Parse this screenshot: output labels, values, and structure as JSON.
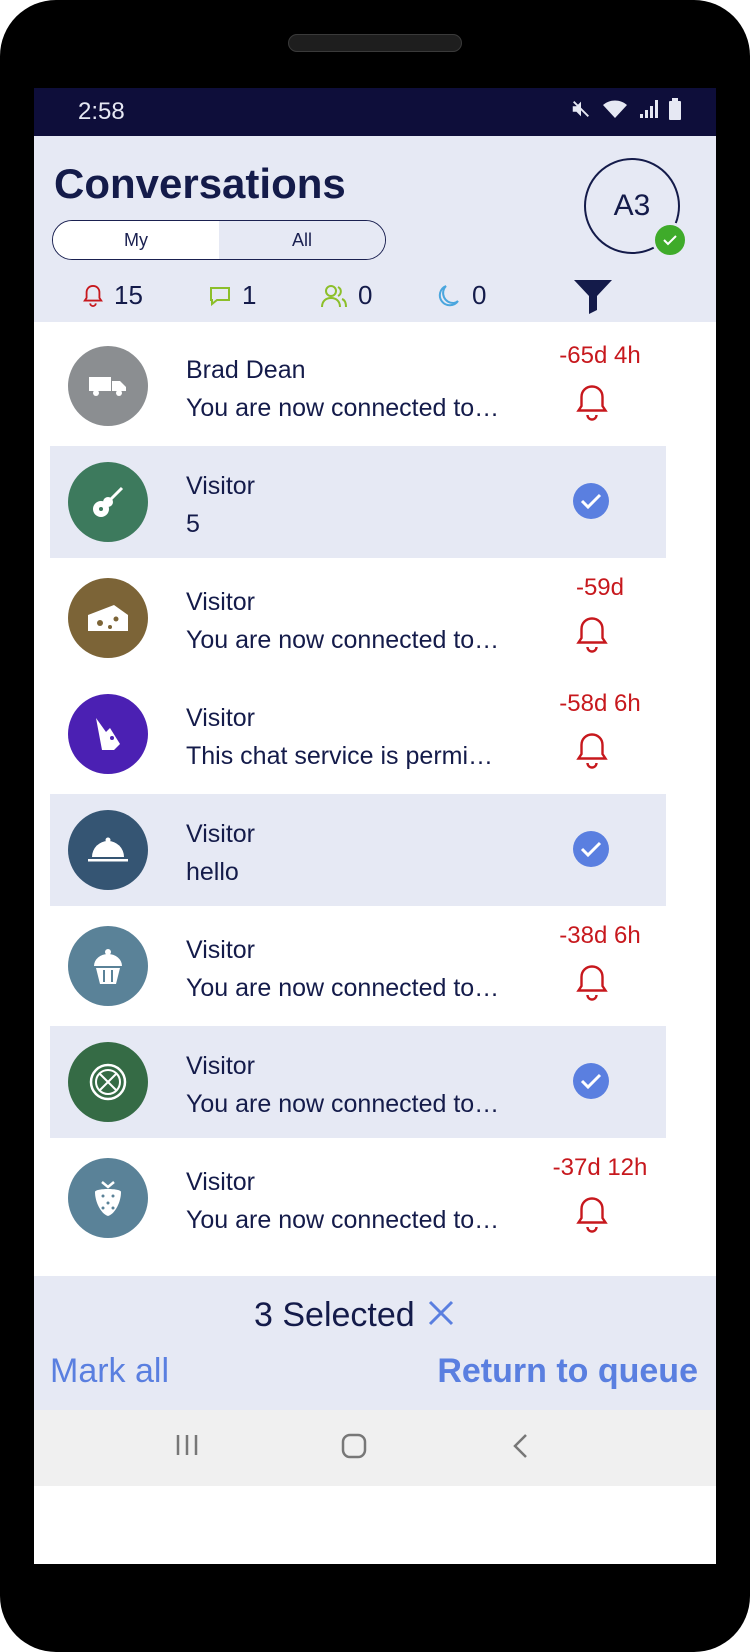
{
  "status": {
    "time": "2:58"
  },
  "header": {
    "title": "Conversations",
    "tabs": [
      {
        "label": "My"
      },
      {
        "label": "All"
      }
    ],
    "avatar_initials": "A3"
  },
  "counters": {
    "alerts": "15",
    "messages": "1",
    "users": "0",
    "away": "0"
  },
  "conversations": [
    {
      "name": "Brad Dean",
      "message": "You are now connected to…",
      "time": "-65d 4h",
      "selected": false,
      "icon": "truck-icon",
      "color": "#8b8e91"
    },
    {
      "name": "Visitor",
      "message": "5",
      "time": "",
      "selected": true,
      "icon": "guitar-icon",
      "color": "#3d7a5d"
    },
    {
      "name": "Visitor",
      "message": "You are now connected to…",
      "time": "-59d",
      "selected": false,
      "icon": "cheese-icon",
      "color": "#7c6437"
    },
    {
      "name": "Visitor",
      "message": "This chat service is permi…",
      "time": "-58d 6h",
      "selected": false,
      "icon": "fox-icon",
      "color": "#4b20b3"
    },
    {
      "name": "Visitor",
      "message": "hello",
      "time": "",
      "selected": true,
      "icon": "cloche-icon",
      "color": "#355573"
    },
    {
      "name": "Visitor",
      "message": "You are now connected to…",
      "time": "-38d 6h",
      "selected": false,
      "icon": "cupcake-icon",
      "color": "#5a8298"
    },
    {
      "name": "Visitor",
      "message": "You are now connected to…",
      "time": "",
      "selected": true,
      "icon": "pizza-icon",
      "color": "#356b45"
    },
    {
      "name": "Visitor",
      "message": "You are now connected to…",
      "time": "-37d 12h",
      "selected": false,
      "icon": "strawberry-icon",
      "color": "#5a8298"
    }
  ],
  "footer": {
    "selected_text": "3 Selected",
    "mark_all": "Mark all",
    "return_to_queue": "Return to queue"
  },
  "colors": {
    "accent": "#5a7fe0",
    "alert": "#c7181d",
    "header_bg": "#e6e9f4",
    "title": "#141b4a",
    "online": "#3fab2a"
  }
}
